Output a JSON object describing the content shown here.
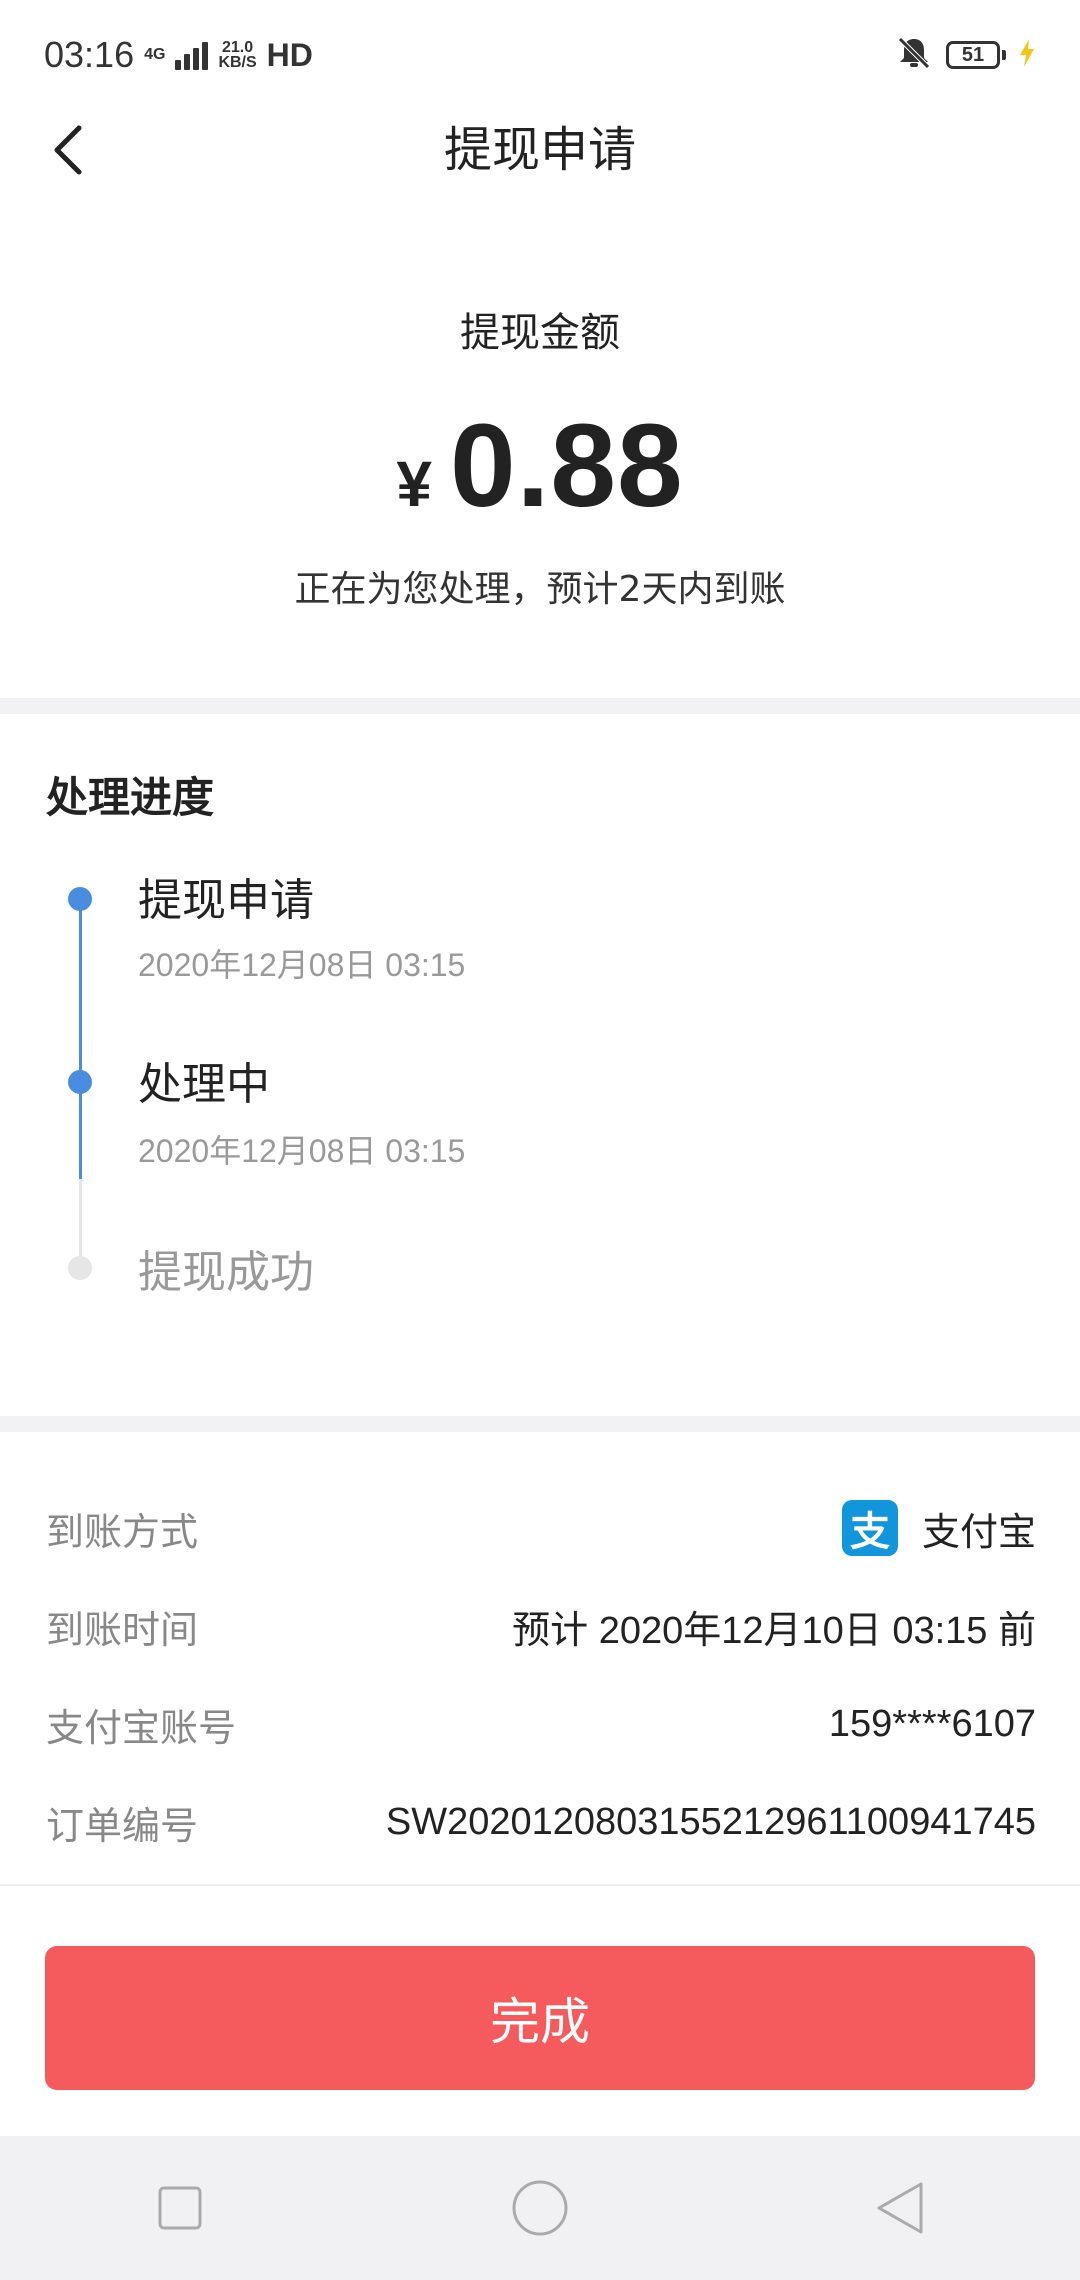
{
  "status_bar": {
    "time": "03:16",
    "network": "4G",
    "speed_value": "21.0",
    "speed_unit": "KB/S",
    "hd": "HD",
    "battery": "51"
  },
  "header": {
    "title": "提现申请",
    "back_icon": "chevron-left-icon"
  },
  "amount": {
    "label": "提现金额",
    "currency": "¥",
    "value": "0.88",
    "note": "正在为您处理，预计2天内到账"
  },
  "progress": {
    "title": "处理进度",
    "steps": [
      {
        "title": "提现申请",
        "time": "2020年12月08日 03:15",
        "active": true
      },
      {
        "title": "处理中",
        "time": "2020年12月08日 03:15",
        "active": true
      },
      {
        "title": "提现成功",
        "time": "",
        "active": false
      }
    ]
  },
  "details": {
    "rows": [
      {
        "label": "到账方式",
        "value": "支付宝",
        "icon": "alipay-icon",
        "icon_glyph": "支"
      },
      {
        "label": "到账时间",
        "value": "预计 2020年12月10日 03:15 前"
      },
      {
        "label": "支付宝账号",
        "value": "159****6107"
      },
      {
        "label": "订单编号",
        "value": "SW2020120803155212961100941745"
      }
    ]
  },
  "done_button": {
    "label": "完成"
  },
  "colors": {
    "accent_blue": "#4a8de0",
    "button_red": "#f55b5d",
    "alipay_blue": "#1296db"
  }
}
